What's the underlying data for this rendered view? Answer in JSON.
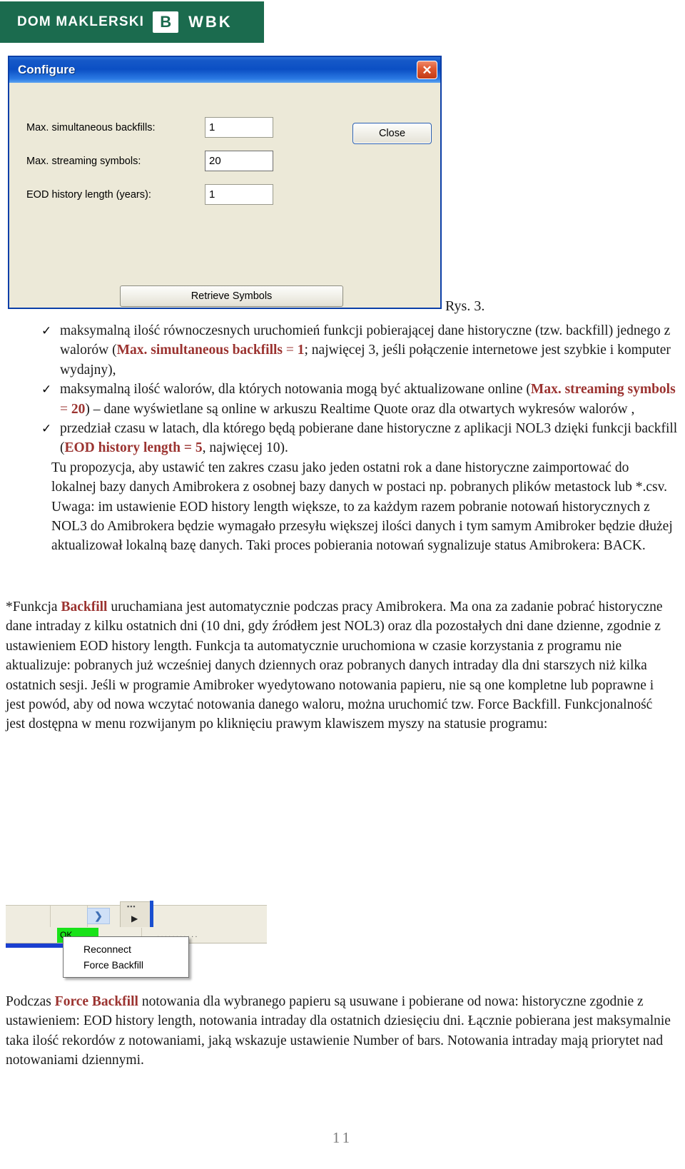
{
  "brand": {
    "text": "DOM MAKLERSKI",
    "logo_letter": "B",
    "suffix": "WBK",
    "green": "#1b6b4e"
  },
  "dialog": {
    "title": "Configure",
    "close_icon": "✕",
    "fields": [
      {
        "label": "Max. simultaneous backfills:",
        "value": "1"
      },
      {
        "label": "Max. streaming symbols:",
        "value": "20"
      },
      {
        "label": "EOD history length (years):",
        "value": "1"
      }
    ],
    "close_button": "Close",
    "retrieve_button": "Retrieve Symbols"
  },
  "figure_caption": "Rys. 3.",
  "bullets": [
    {
      "tick": "✓",
      "parts": [
        {
          "t": "maksymalną ilość równoczesnych uruchomień funkcji pobierającej dane historyczne (tzw. backfill) jednego z walorów (",
          "k": "n"
        },
        {
          "t": "Max. simultaneous backfills",
          "k": "b"
        },
        {
          "t": " = ",
          "k": "r"
        },
        {
          "t": "1",
          "k": "b"
        },
        {
          "t": "; najwięcej 3, jeśli połączenie internetowe jest szybkie i komputer wydajny),",
          "k": "n"
        }
      ]
    },
    {
      "tick": "✓",
      "parts": [
        {
          "t": "maksymalną ilość walorów, dla których notowania mogą być aktualizowane online (",
          "k": "n"
        },
        {
          "t": "Max. streaming symbols",
          "k": "b"
        },
        {
          "t": " = ",
          "k": "r"
        },
        {
          "t": "20",
          "k": "b"
        },
        {
          "t": ") – dane wyświetlane są online w arkuszu Realtime Quote oraz dla otwartych wykresów walorów ,",
          "k": "n"
        }
      ]
    },
    {
      "tick": "✓",
      "parts": [
        {
          "t": "przedział czasu w latach, dla którego będą pobierane dane historyczne z aplikacji NOL3 dzięki funkcji backfill (",
          "k": "n"
        },
        {
          "t": "EOD history length = 5",
          "k": "b"
        },
        {
          "t": ", najwięcej 10).",
          "k": "n"
        }
      ]
    }
  ],
  "paragraphs": {
    "p1": "Tu propozycja, aby ustawić ten zakres czasu jako jeden ostatni rok a dane historyczne zaimportować do lokalnej bazy danych Amibrokera z osobnej bazy danych w postaci np. pobranych plików metastock lub *.csv.",
    "p2": "Uwaga: im ustawienie EOD history length większe, to za każdym razem pobranie notowań historycznych z NOL3  do Amibrokera będzie wymagało przesyłu większej ilości danych i tym samym Amibroker będzie dłużej aktualizował lokalną bazę danych. Taki proces pobierania notowań sygnalizuje status Amibrokera: BACK.",
    "p3_pre": "*Funkcja ",
    "p3_hl": "Backfill",
    "p3_post": " uruchamiana jest automatycznie podczas pracy Amibrokera. Ma ona za zadanie pobrać historyczne dane intraday z kilku ostatnich dni (10 dni, gdy źródłem jest NOL3) oraz dla pozostałych dni dane dzienne, zgodnie z ustawieniem EOD history length. Funkcja ta automatycznie uruchomiona w czasie korzystania z programu nie aktualizuje: pobranych już wcześniej danych dziennych oraz pobranych danych intraday dla dni starszych niż kilka ostatnich sesji. Jeśli w programie Amibroker wyedytowano notowania papieru, nie są one kompletne lub poprawne i jest powód, aby od nowa wczytać  notowania danego waloru, można uruchomić tzw. Force Backfill. Funkcjonalność jest dostępna w menu rozwijanym po kliknięciu prawym klawiszem myszy na statusie programu:",
    "p4_pre": "Podczas ",
    "p4_hl": "Force Backfill",
    "p4_post": " notowania dla wybranego papieru są usuwane i pobierane od nowa: historyczne zgodnie z ustawieniem: EOD history length, notowania intraday dla ostatnich dziesięciu dni. Łącznie pobierana jest maksymalnie taka ilość rekordów z notowaniami, jaką wskazuje ustawienie Number of bars. Notowania intraday mają priorytet nad notowaniami dziennymi."
  },
  "mini_screenshot": {
    "status_ok": "OK",
    "arrow_icon": "❯",
    "play_icon": "▶",
    "grip_dots": "▪▪▪",
    "dot_line": "···········",
    "context_menu": [
      "Reconnect",
      "Force Backfill"
    ]
  },
  "page_number": "11",
  "colors": {
    "highlight": "#9b3330",
    "title_blue": "#0b4fc4",
    "dialog_face": "#ece9d8",
    "ok_green": "#19e219"
  }
}
